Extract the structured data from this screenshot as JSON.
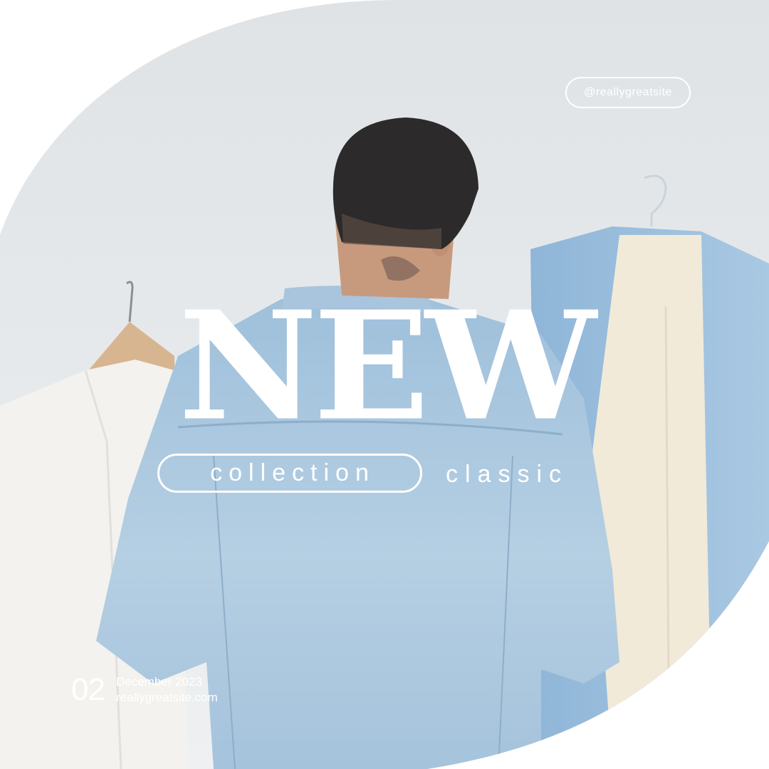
{
  "social": {
    "handle": "@reallygreatsite"
  },
  "headline": {
    "title": "NEW"
  },
  "tagline": {
    "pill_text": "collection",
    "side_text": "classic"
  },
  "footer": {
    "page_number": "02",
    "date": "December 2023",
    "website": "reallygreatsite.com"
  },
  "colors": {
    "text": "#ffffff",
    "background": "#ffffff",
    "denim": "#a9c7e0",
    "wall": "#e3e7ea"
  }
}
